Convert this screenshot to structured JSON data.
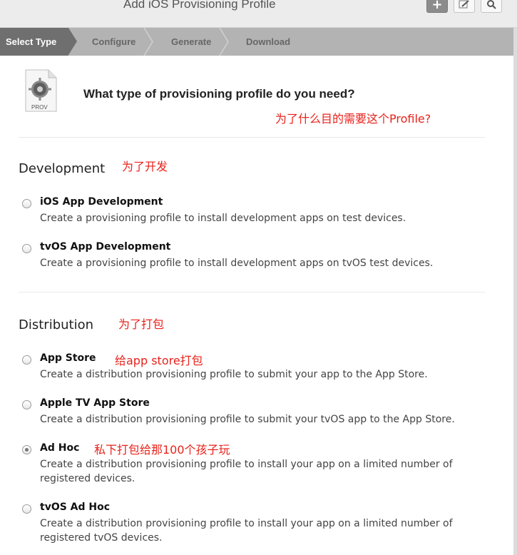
{
  "window": {
    "title": "Add iOS Provisioning Profile",
    "toolbar": {
      "add_label": "+"
    }
  },
  "steps": [
    "Select Type",
    "Configure",
    "Generate",
    "Download"
  ],
  "header": {
    "icon_label": "PROV",
    "question": "What type of provisioning profile do you need?",
    "annotation": "为了什么目的需要这个Profile?"
  },
  "development": {
    "title": "Development",
    "annotation": "为了开发",
    "options": [
      {
        "title": "iOS App Development",
        "desc": "Create a provisioning profile to install development apps on test devices."
      },
      {
        "title": "tvOS App Development",
        "desc": "Create a provisioning profile to install development apps on tvOS test devices."
      }
    ]
  },
  "distribution": {
    "title": "Distribution",
    "annotation": "为了打包",
    "options": [
      {
        "title": "App Store",
        "annotation": "给app store打包",
        "desc": "Create a distribution provisioning profile to submit your app to the App Store."
      },
      {
        "title": "Apple TV App Store",
        "desc": "Create a distribution provisioning profile to submit your tvOS app to the App Store."
      },
      {
        "title": "Ad Hoc",
        "annotation": "私下打包给那100个孩子玩",
        "desc": "Create a distribution provisioning profile to install your app on a limited number of registered devices.",
        "selected": true
      },
      {
        "title": "tvOS Ad Hoc",
        "desc": "Create a distribution provisioning profile to install your app on a limited number of registered tvOS devices."
      }
    ]
  },
  "colors": {
    "annotation": "#e8221b",
    "active_step": "#6f6f6f",
    "steps_bar": "#b3b3b3"
  }
}
